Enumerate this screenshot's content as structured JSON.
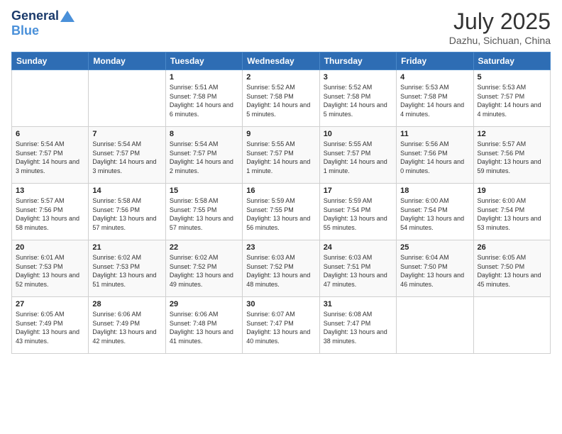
{
  "header": {
    "logo_general": "General",
    "logo_blue": "Blue",
    "title": "July 2025",
    "location": "Dazhu, Sichuan, China"
  },
  "weekdays": [
    "Sunday",
    "Monday",
    "Tuesday",
    "Wednesday",
    "Thursday",
    "Friday",
    "Saturday"
  ],
  "weeks": [
    [
      {
        "day": "",
        "info": ""
      },
      {
        "day": "",
        "info": ""
      },
      {
        "day": "1",
        "info": "Sunrise: 5:51 AM\nSunset: 7:58 PM\nDaylight: 14 hours and 6 minutes."
      },
      {
        "day": "2",
        "info": "Sunrise: 5:52 AM\nSunset: 7:58 PM\nDaylight: 14 hours and 5 minutes."
      },
      {
        "day": "3",
        "info": "Sunrise: 5:52 AM\nSunset: 7:58 PM\nDaylight: 14 hours and 5 minutes."
      },
      {
        "day": "4",
        "info": "Sunrise: 5:53 AM\nSunset: 7:58 PM\nDaylight: 14 hours and 4 minutes."
      },
      {
        "day": "5",
        "info": "Sunrise: 5:53 AM\nSunset: 7:57 PM\nDaylight: 14 hours and 4 minutes."
      }
    ],
    [
      {
        "day": "6",
        "info": "Sunrise: 5:54 AM\nSunset: 7:57 PM\nDaylight: 14 hours and 3 minutes."
      },
      {
        "day": "7",
        "info": "Sunrise: 5:54 AM\nSunset: 7:57 PM\nDaylight: 14 hours and 3 minutes."
      },
      {
        "day": "8",
        "info": "Sunrise: 5:54 AM\nSunset: 7:57 PM\nDaylight: 14 hours and 2 minutes."
      },
      {
        "day": "9",
        "info": "Sunrise: 5:55 AM\nSunset: 7:57 PM\nDaylight: 14 hours and 1 minute."
      },
      {
        "day": "10",
        "info": "Sunrise: 5:55 AM\nSunset: 7:57 PM\nDaylight: 14 hours and 1 minute."
      },
      {
        "day": "11",
        "info": "Sunrise: 5:56 AM\nSunset: 7:56 PM\nDaylight: 14 hours and 0 minutes."
      },
      {
        "day": "12",
        "info": "Sunrise: 5:57 AM\nSunset: 7:56 PM\nDaylight: 13 hours and 59 minutes."
      }
    ],
    [
      {
        "day": "13",
        "info": "Sunrise: 5:57 AM\nSunset: 7:56 PM\nDaylight: 13 hours and 58 minutes."
      },
      {
        "day": "14",
        "info": "Sunrise: 5:58 AM\nSunset: 7:56 PM\nDaylight: 13 hours and 57 minutes."
      },
      {
        "day": "15",
        "info": "Sunrise: 5:58 AM\nSunset: 7:55 PM\nDaylight: 13 hours and 57 minutes."
      },
      {
        "day": "16",
        "info": "Sunrise: 5:59 AM\nSunset: 7:55 PM\nDaylight: 13 hours and 56 minutes."
      },
      {
        "day": "17",
        "info": "Sunrise: 5:59 AM\nSunset: 7:54 PM\nDaylight: 13 hours and 55 minutes."
      },
      {
        "day": "18",
        "info": "Sunrise: 6:00 AM\nSunset: 7:54 PM\nDaylight: 13 hours and 54 minutes."
      },
      {
        "day": "19",
        "info": "Sunrise: 6:00 AM\nSunset: 7:54 PM\nDaylight: 13 hours and 53 minutes."
      }
    ],
    [
      {
        "day": "20",
        "info": "Sunrise: 6:01 AM\nSunset: 7:53 PM\nDaylight: 13 hours and 52 minutes."
      },
      {
        "day": "21",
        "info": "Sunrise: 6:02 AM\nSunset: 7:53 PM\nDaylight: 13 hours and 51 minutes."
      },
      {
        "day": "22",
        "info": "Sunrise: 6:02 AM\nSunset: 7:52 PM\nDaylight: 13 hours and 49 minutes."
      },
      {
        "day": "23",
        "info": "Sunrise: 6:03 AM\nSunset: 7:52 PM\nDaylight: 13 hours and 48 minutes."
      },
      {
        "day": "24",
        "info": "Sunrise: 6:03 AM\nSunset: 7:51 PM\nDaylight: 13 hours and 47 minutes."
      },
      {
        "day": "25",
        "info": "Sunrise: 6:04 AM\nSunset: 7:50 PM\nDaylight: 13 hours and 46 minutes."
      },
      {
        "day": "26",
        "info": "Sunrise: 6:05 AM\nSunset: 7:50 PM\nDaylight: 13 hours and 45 minutes."
      }
    ],
    [
      {
        "day": "27",
        "info": "Sunrise: 6:05 AM\nSunset: 7:49 PM\nDaylight: 13 hours and 43 minutes."
      },
      {
        "day": "28",
        "info": "Sunrise: 6:06 AM\nSunset: 7:49 PM\nDaylight: 13 hours and 42 minutes."
      },
      {
        "day": "29",
        "info": "Sunrise: 6:06 AM\nSunset: 7:48 PM\nDaylight: 13 hours and 41 minutes."
      },
      {
        "day": "30",
        "info": "Sunrise: 6:07 AM\nSunset: 7:47 PM\nDaylight: 13 hours and 40 minutes."
      },
      {
        "day": "31",
        "info": "Sunrise: 6:08 AM\nSunset: 7:47 PM\nDaylight: 13 hours and 38 minutes."
      },
      {
        "day": "",
        "info": ""
      },
      {
        "day": "",
        "info": ""
      }
    ]
  ]
}
